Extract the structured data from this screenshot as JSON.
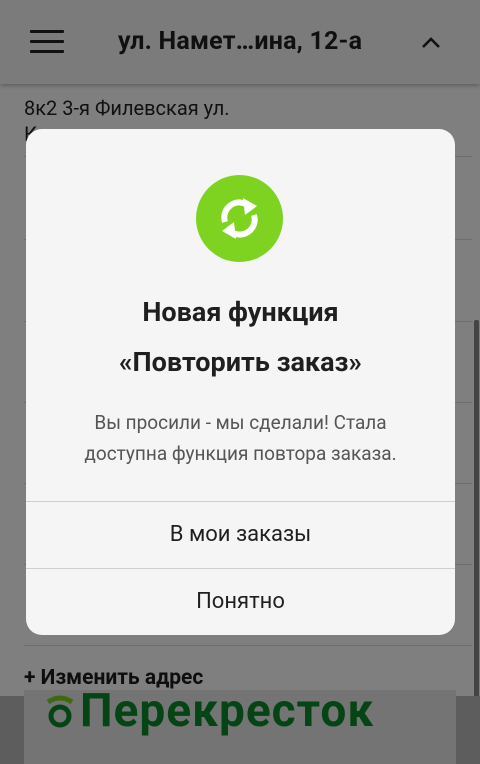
{
  "header": {
    "address_title": "ул. Намет…ина, 12-а"
  },
  "address_list": {
    "first_line": "8к2 3-я Филевская ул.",
    "first_line_cont": "К",
    "change_address": "+ Изменить адрес"
  },
  "promo": {
    "logo_text": "Перекресток"
  },
  "dialog": {
    "title_line1": "Новая функция",
    "title_line2": "«Повторить заказ»",
    "body_line1": "Вы просили - мы сделали! Стала",
    "body_line2": "доступна функция повтора заказа.",
    "primary_button": "В мои заказы",
    "secondary_button": "Понятно",
    "icon": "refresh-icon",
    "icon_color": "#7ed321"
  },
  "colors": {
    "scrim": "rgba(0,0,0,0.5)",
    "brand_green": "#0a8a2a"
  }
}
